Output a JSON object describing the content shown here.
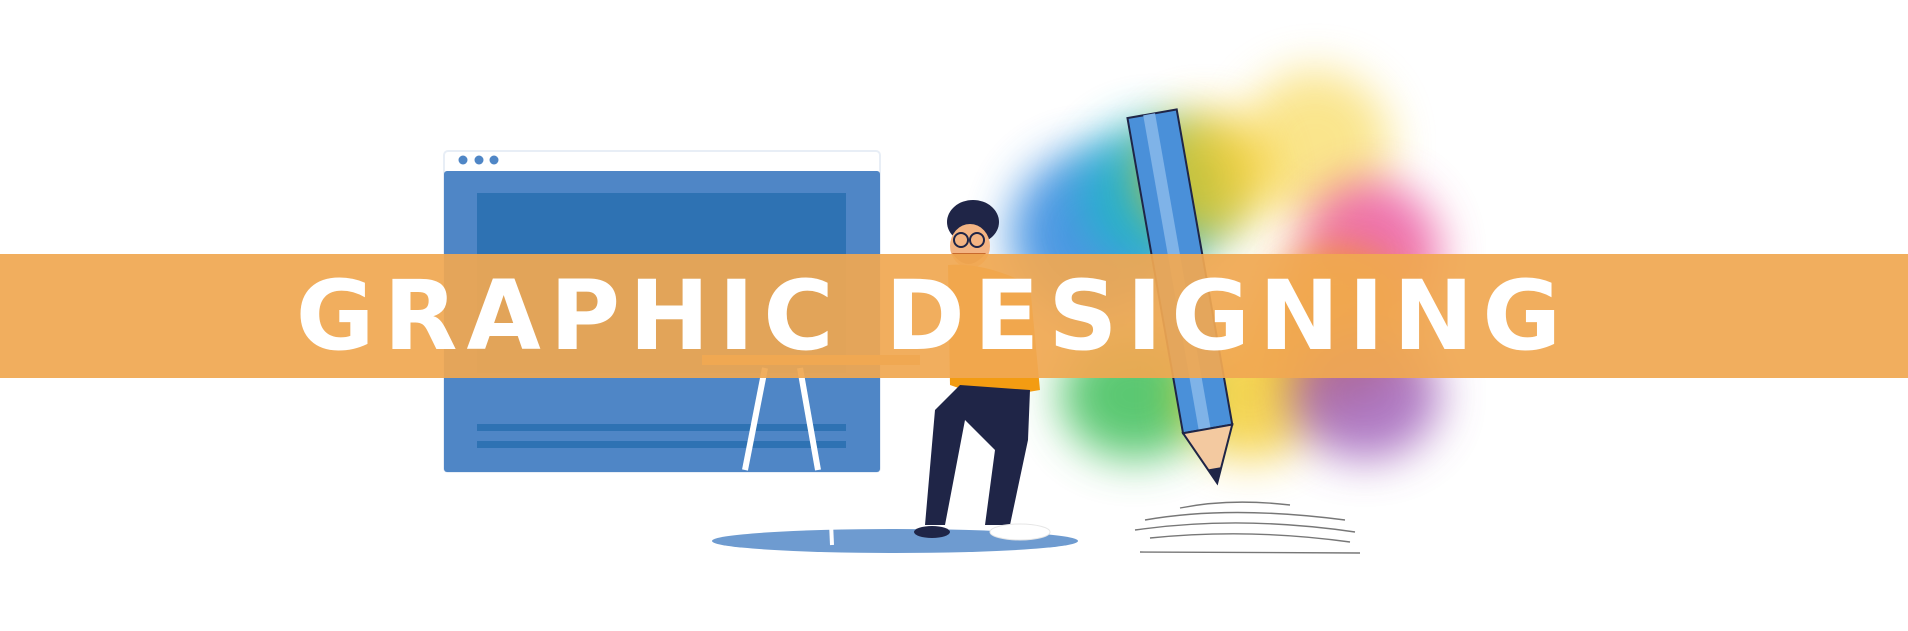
{
  "banner": {
    "title": "GRAPHIC  DESIGNING",
    "color": "#F0A852"
  },
  "illustration": {
    "browser_window_color": "#4F86C6",
    "figure": "designer-seated-at-desk",
    "pencil_color": "#4A90D9",
    "splash_colors": [
      "#2E86DE",
      "#21B5C8",
      "#3FBF5A",
      "#F6D02F",
      "#F39C12",
      "#E84393",
      "#9B59B6"
    ]
  }
}
